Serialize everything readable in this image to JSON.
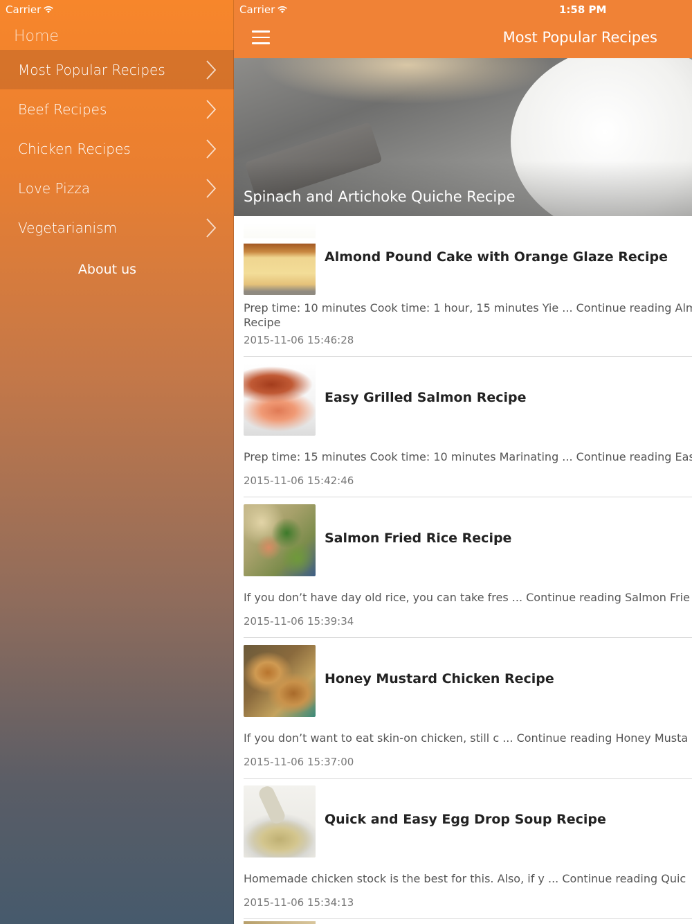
{
  "drawer": {
    "carrier": "Carrier",
    "home": "Home",
    "items": [
      {
        "label": "Most Popular Recipes",
        "active": true
      },
      {
        "label": "Beef Recipes",
        "active": false
      },
      {
        "label": "Chicken Recipes",
        "active": false
      },
      {
        "label": "Love Pizza",
        "active": false
      },
      {
        "label": "Vegetarianism",
        "active": false
      }
    ],
    "about": "About us"
  },
  "main": {
    "carrier": "Carrier",
    "time": "1:58 PM",
    "title": "Most Popular Recipes",
    "hero_title": "Spinach and Artichoke Quiche Recipe",
    "recipes": [
      {
        "title": "Almond Pound Cake with Orange Glaze Recipe",
        "excerpt_line1": "Prep time: 10 minutes Cook time: 1 hour, 15 minutes Yie ... Continue reading Alm",
        "excerpt_line2": "Recipe",
        "date": "2015-11-06 15:46:28"
      },
      {
        "title": "Easy Grilled Salmon Recipe",
        "excerpt_line1": "Prep time: 15 minutes Cook time: 10 minutes Marinating ... Continue reading Eas",
        "excerpt_line2": "",
        "date": "2015-11-06 15:42:46"
      },
      {
        "title": "Salmon Fried Rice Recipe",
        "excerpt_line1": "If you don’t have day old rice, you can take fres ... Continue reading Salmon Frie",
        "excerpt_line2": "",
        "date": "2015-11-06 15:39:34"
      },
      {
        "title": "Honey Mustard Chicken Recipe",
        "excerpt_line1": "If you don’t want to eat skin-on chicken, still c ... Continue reading Honey Musta",
        "excerpt_line2": "",
        "date": "2015-11-06 15:37:00"
      },
      {
        "title": "Quick and Easy Egg Drop Soup Recipe",
        "excerpt_line1": "Homemade chicken stock is the best for this. Also, if y ... Continue reading Quic",
        "excerpt_line2": "",
        "date": "2015-11-06 15:34:13"
      }
    ]
  },
  "colors": {
    "navbar": "#f08236",
    "drawer_top": "#f7862b",
    "drawer_bottom": "#465a6c"
  }
}
